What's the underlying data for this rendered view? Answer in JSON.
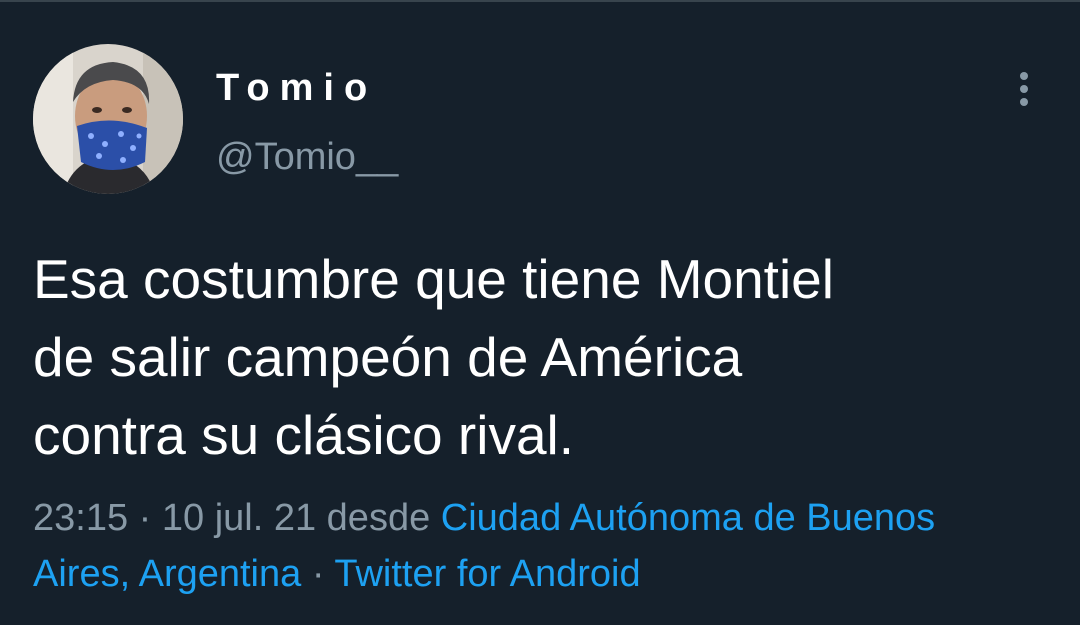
{
  "tweet": {
    "display_name": "Tomio",
    "handle": "@Tomio__",
    "text_lines": [
      "Esa costumbre que tiene Montiel",
      "de salir campeón de América",
      "contra su clásico rival."
    ],
    "time": "23:15",
    "date": "10 jul. 21",
    "separator": "·",
    "from_label": "desde",
    "location_line1": "Ciudad Autónoma de Buenos",
    "location_line2": "Aires, Argentina",
    "source": "Twitter for Android"
  },
  "icons": {
    "more": "more-vertical-icon",
    "avatar": "profile-avatar"
  },
  "colors": {
    "background": "#15202b",
    "text_primary": "#ffffff",
    "text_secondary": "#8899a6",
    "link": "#1da1f2"
  }
}
